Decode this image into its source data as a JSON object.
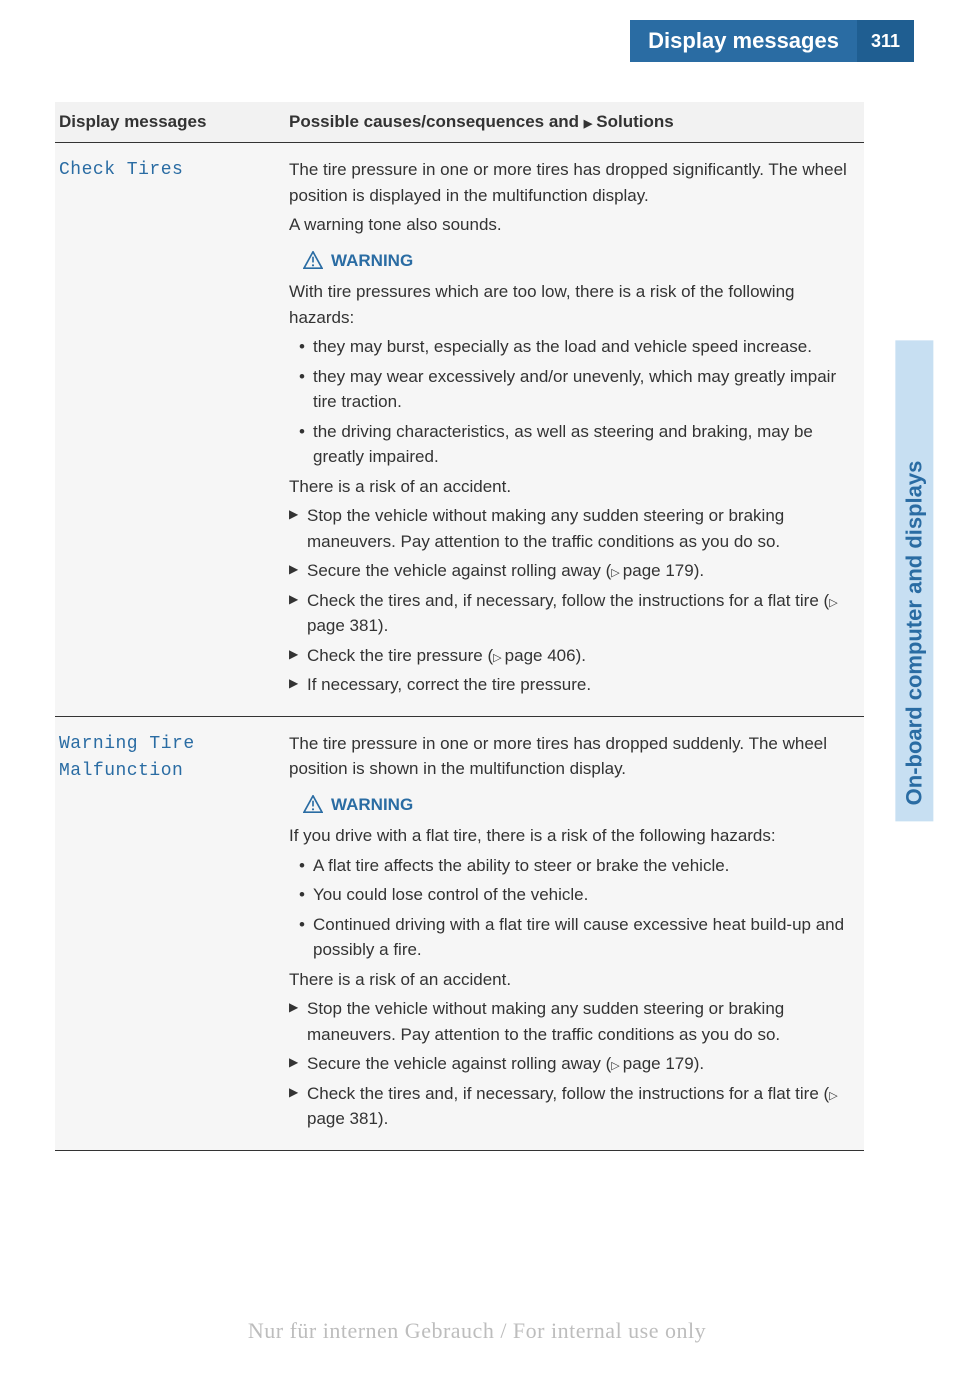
{
  "header": {
    "title": "Display messages",
    "page_number": "311"
  },
  "side_tab": "On-board computer and displays",
  "table": {
    "columns": {
      "messages": "Display messages",
      "solutions_prefix": "Possible causes/consequences and ",
      "solutions_suffix": "Solutions"
    },
    "rows": [
      {
        "message": "Check Tires",
        "intro1": "The tire pressure in one or more tires has dropped significantly. The wheel position is displayed in the multifunction display.",
        "intro2": "A warning tone also sounds.",
        "warning_label": "WARNING",
        "warning_intro": "With tire pressures which are too low, there is a risk of the following hazards:",
        "hazards": [
          "they may burst, especially as the load and vehicle speed increase.",
          "they may wear excessively and/or unevenly, which may greatly impair tire traction.",
          "the driving characteristics, as well as steering and braking, may be greatly impaired."
        ],
        "risk": "There is a risk of an accident.",
        "actions": [
          {
            "text": "Stop the vehicle without making any sudden steering or braking maneuvers. Pay attention to the traffic conditions as you do so."
          },
          {
            "text": "Secure the vehicle against rolling away (",
            "pageref": "page 179",
            "tail": ")."
          },
          {
            "text": "Check the tires and, if necessary, follow the instructions for a flat tire (",
            "pageref": "page 381",
            "tail": ")."
          },
          {
            "text": "Check the tire pressure (",
            "pageref": "page 406",
            "tail": ")."
          },
          {
            "text": "If necessary, correct the tire pressure."
          }
        ]
      },
      {
        "message": "Warning Tire Malfunction",
        "intro1": "The tire pressure in one or more tires has dropped suddenly. The wheel position is shown in the multifunction display.",
        "warning_label": "WARNING",
        "warning_intro": "If you drive with a flat tire, there is a risk of the following hazards:",
        "hazards": [
          "A flat tire affects the ability to steer or brake the vehicle.",
          "You could lose control of the vehicle.",
          "Continued driving with a flat tire will cause excessive heat build-up and possibly a fire."
        ],
        "risk": "There is a risk of an accident.",
        "actions": [
          {
            "text": "Stop the vehicle without making any sudden steering or braking maneuvers. Pay attention to the traffic conditions as you do so."
          },
          {
            "text": "Secure the vehicle against rolling away (",
            "pageref": "page 179",
            "tail": ")."
          },
          {
            "text": "Check the tires and, if necessary, follow the instructions for a flat tire (",
            "pageref": "page 381",
            "tail": ")."
          }
        ]
      }
    ]
  },
  "footer": "Nur für internen Gebrauch / For internal use only"
}
